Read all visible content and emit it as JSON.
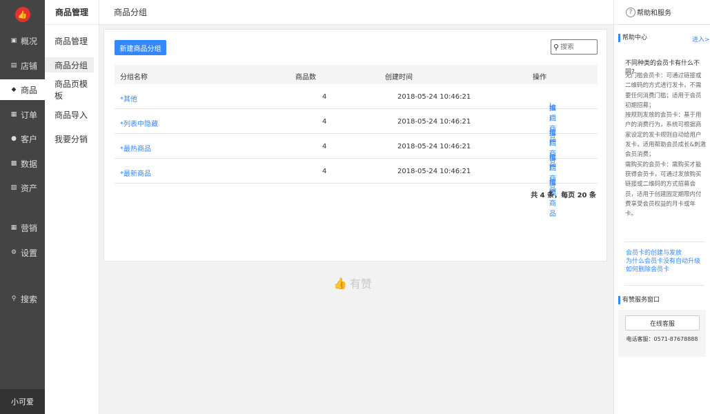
{
  "nav": {
    "items": [
      {
        "icon": "monitor-icon",
        "label": "概况"
      },
      {
        "icon": "store-icon",
        "label": "店铺"
      },
      {
        "icon": "tag-icon",
        "label": "商品"
      },
      {
        "icon": "clipboard-icon",
        "label": "订单"
      },
      {
        "icon": "user-icon",
        "label": "客户"
      },
      {
        "icon": "chart-icon",
        "label": "数据"
      },
      {
        "icon": "wallet-icon",
        "label": "资产"
      },
      {
        "icon": "grid-icon",
        "label": "营销"
      },
      {
        "icon": "gear-icon",
        "label": "设置"
      },
      {
        "icon": "search-icon",
        "label": "搜索"
      }
    ],
    "active": "商品",
    "user": "小可爱"
  },
  "subnav": {
    "title": "商品管理",
    "items": [
      "商品管理",
      "商品分组",
      "商品页模板",
      "商品导入",
      "我要分销"
    ],
    "active": "商品分组"
  },
  "header": {
    "title": "商品分组"
  },
  "toolbar": {
    "new_button": "新建商品分组",
    "search_placeholder": "搜索"
  },
  "table": {
    "columns": [
      "分组名称",
      "商品数",
      "创建时间",
      "操作"
    ],
    "rows": [
      {
        "name": "*其他",
        "count": "4",
        "created": "2018-05-24 10:46:21",
        "edit": "编辑",
        "sep": "|",
        "promote": "推广商品"
      },
      {
        "name": "*列表中隐藏",
        "count": "4",
        "created": "2018-05-24 10:46:21",
        "edit": "编辑",
        "sep": "|",
        "promote": "推广商品"
      },
      {
        "name": "*最热商品",
        "count": "4",
        "created": "2018-05-24 10:46:21",
        "edit": "编辑",
        "sep": "|",
        "promote": "推广商品"
      },
      {
        "name": "*最新商品",
        "count": "4",
        "created": "2018-05-24 10:46:21",
        "edit": "编辑",
        "sep": "|",
        "promote": "推广商品"
      }
    ],
    "pagination": "共 4 条，每页 20 条"
  },
  "brand": {
    "text": "有赞"
  },
  "help": {
    "header": "帮助和服务",
    "center_title": "帮助中心",
    "enter": "进入>",
    "question": "不同种类的会员卡有什么不同？",
    "body": "无门槛会员卡：可通过链接或二维码的方式进行发卡，不需要任何消费门槛；适用于会员初期招募；\n按规则发放的会员卡：基于用户的消费行为，系统可根据商家设定的发卡规则自动给用户发卡，适用帮助会员成长&刺激会员消费；\n需购买的会员卡：需购买才能获得会员卡，可通过发放购买链接或二维码的方式招募会员，适用于创建固定期限内付费享受会员权益的月卡或年卡。",
    "links": [
      "会员卡的创建与发放",
      "为什么会员卡没有自动升级",
      "如何删除会员卡"
    ],
    "service_title": "有赞服务窗口",
    "service_button": "在线客服",
    "phone": "电话客服：0571-87678888"
  },
  "colors": {
    "accent": "#3388ff",
    "nav_bg": "#444444",
    "logo": "#e5322d"
  }
}
